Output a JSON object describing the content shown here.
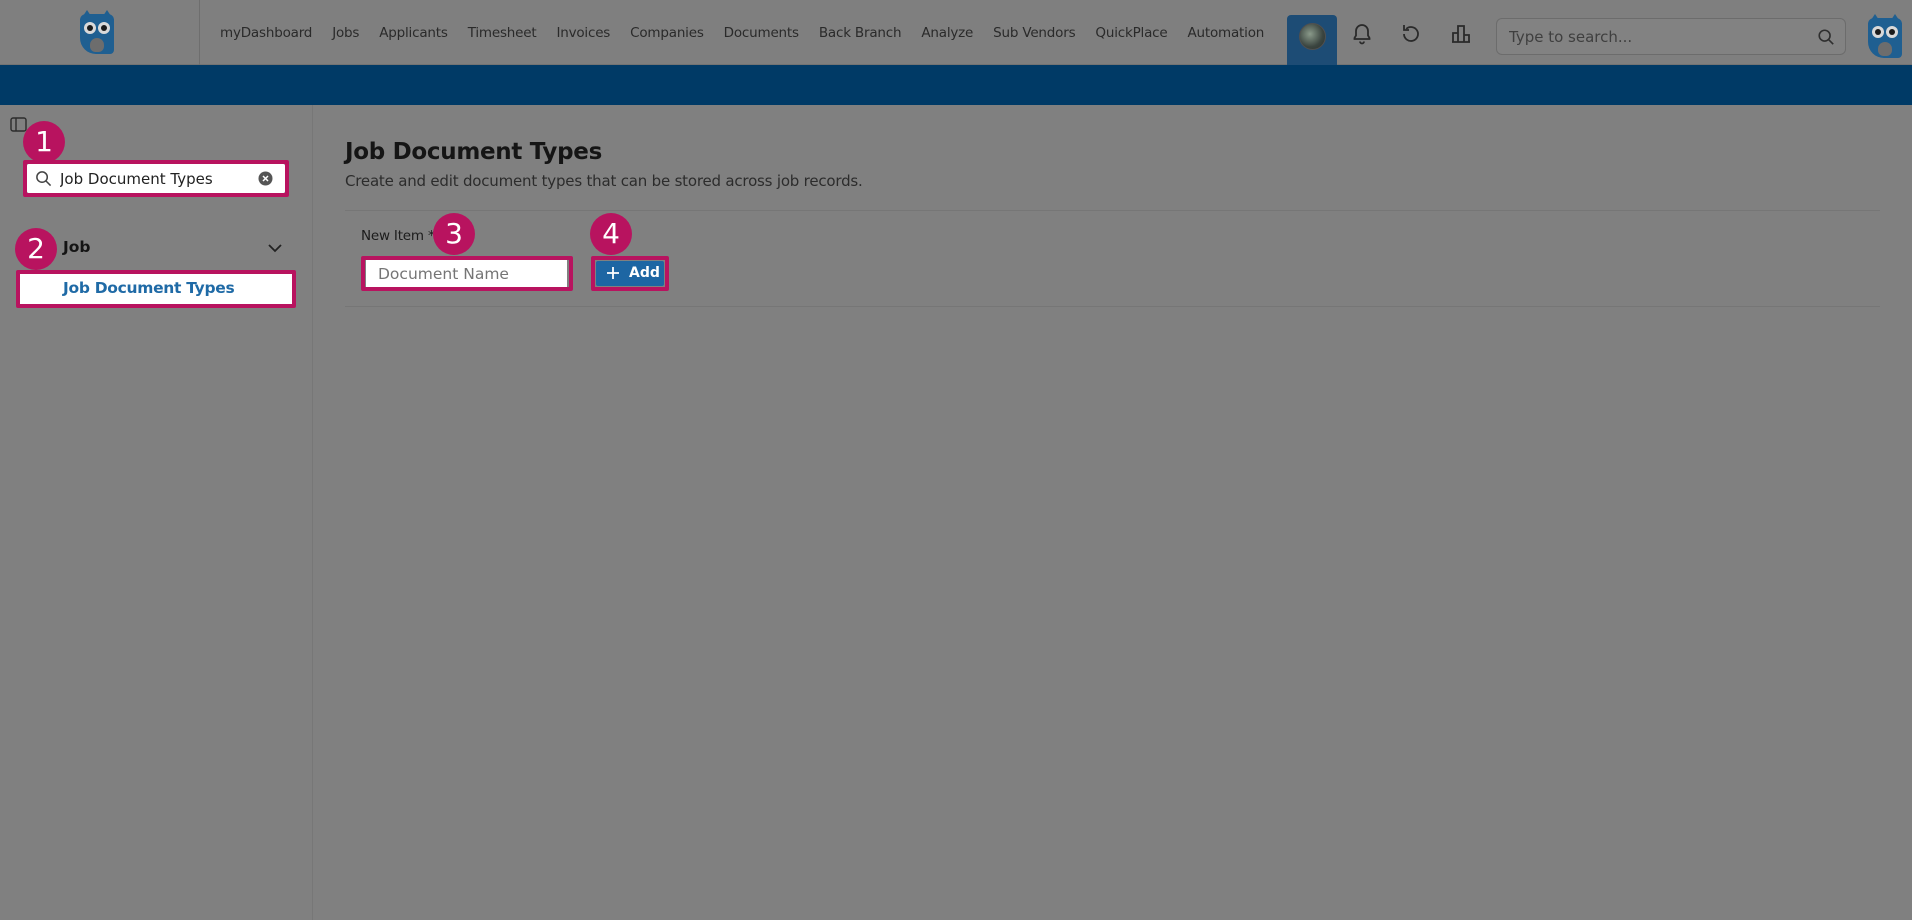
{
  "header": {
    "nav": [
      "myDashboard",
      "Jobs",
      "Applicants",
      "Timesheet",
      "Invoices",
      "Companies",
      "Documents",
      "Back Branch",
      "Analyze",
      "Sub Vendors",
      "QuickPlace",
      "Automation"
    ],
    "search_placeholder": "Type to search...",
    "icons": [
      "bell-icon",
      "history-icon",
      "chart-icon",
      "search-icon"
    ]
  },
  "sidebar": {
    "search_value": "Job Document Types",
    "group": "Job",
    "item": "Job Document Types"
  },
  "main": {
    "title": "Job Document Types",
    "subtitle": "Create and edit document types that can be stored across job records.",
    "new_item_label": "New Item *",
    "input_placeholder": "Document Name",
    "add_label": "Add"
  },
  "callouts": [
    "1",
    "2",
    "3",
    "4"
  ],
  "colors": {
    "accent": "#b8135f",
    "band": "#003a66",
    "primary": "#1d66a3"
  }
}
